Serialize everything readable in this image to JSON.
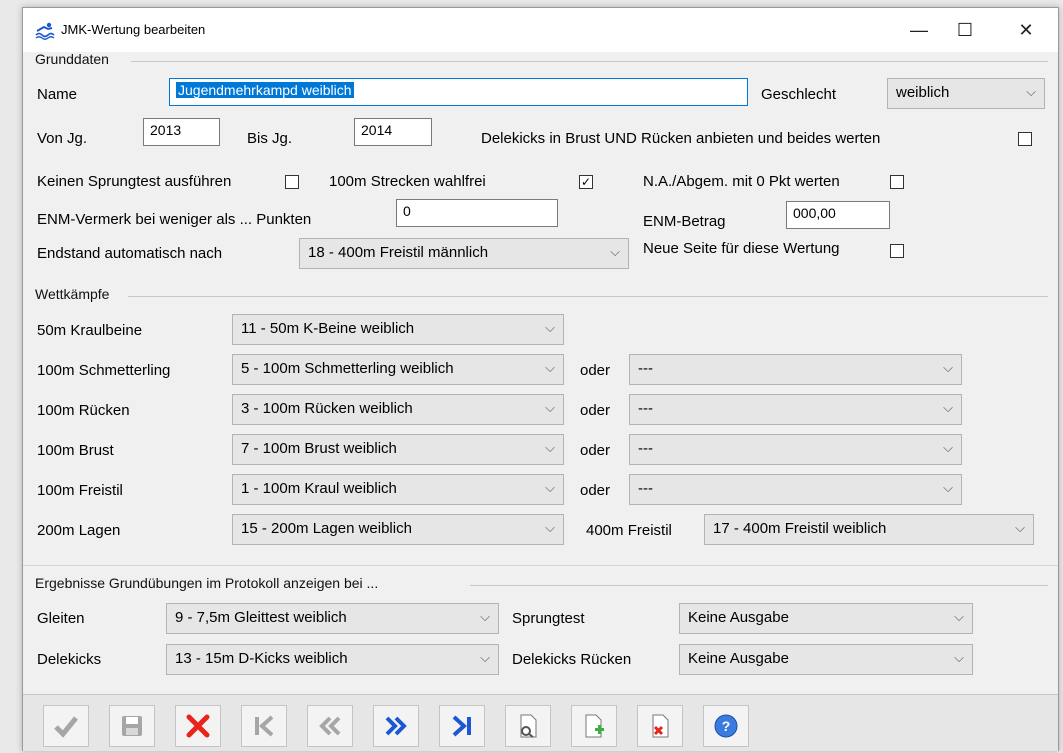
{
  "window": {
    "title": "JMK-Wertung bearbeiten"
  },
  "grunddaten": {
    "group_label": "Grunddaten",
    "name_label": "Name",
    "name_value": "Jugendmehrkampd weiblich",
    "geschlecht_label": "Geschlecht",
    "geschlecht_value": "weiblich",
    "von_label": "Von Jg.",
    "von_value": "2013",
    "bis_label": "Bis Jg.",
    "bis_value": "2014",
    "delekicks_label": "Delekicks in Brust UND Rücken anbieten und beides werten",
    "delekicks_checked": false,
    "sprungtest_label": "Keinen Sprungtest ausführen",
    "sprungtest_checked": false,
    "strecken_label": "100m Strecken wahlfrei",
    "strecken_checked": true,
    "na_label": "N.A./Abgem. mit 0 Pkt werten",
    "na_checked": false,
    "enm_vermerk_label": "ENM-Vermerk bei weniger als ... Punkten",
    "enm_vermerk_value": "0",
    "enm_betrag_label": "ENM-Betrag",
    "enm_betrag_value": "000,00",
    "endstand_label": "Endstand automatisch nach",
    "endstand_value": "18 - 400m Freistil männlich",
    "neue_seite_label": "Neue Seite für diese Wertung",
    "neue_seite_checked": false
  },
  "wettkaempfe": {
    "group_label": "Wettkämpfe",
    "oder": "oder",
    "rows": [
      {
        "label": "50m Kraulbeine",
        "value": "11 - 50m K-Beine weiblich"
      },
      {
        "label": "100m Schmetterling",
        "value": "5 - 100m Schmetterling weiblich",
        "alt": "---"
      },
      {
        "label": "100m Rücken",
        "value": "3 - 100m Rücken weiblich",
        "alt": "---"
      },
      {
        "label": "100m Brust",
        "value": "7 - 100m Brust weiblich",
        "alt": "---"
      },
      {
        "label": "100m Freistil",
        "value": "1 - 100m Kraul weiblich",
        "alt": "---"
      },
      {
        "label": "200m Lagen",
        "value": "15 - 200m Lagen weiblich"
      }
    ],
    "freistil400_label": "400m Freistil",
    "freistil400_value": "17 - 400m Freistil weiblich"
  },
  "ergebnisse": {
    "group_label": "Ergebnisse Grundübungen im Protokoll anzeigen bei ...",
    "gleiten_label": "Gleiten",
    "gleiten_value": "9 - 7,5m Gleittest weiblich",
    "delekicks_label": "Delekicks",
    "delekicks_value": "13 - 15m D-Kicks weiblich",
    "sprungtest_label": "Sprungtest",
    "sprungtest_value": "Keine Ausgabe",
    "delekicks_ruecken_label": "Delekicks Rücken",
    "delekicks_ruecken_value": "Keine Ausgabe"
  },
  "icons": {
    "arrow": "⌵",
    "minimize": "—",
    "maximize": "☐",
    "close": "✕",
    "check": "✓"
  },
  "colors": {
    "selection": "#0078d7",
    "red_icon": "#e8251d",
    "blue_icon": "#1c58d4",
    "disabled_icon": "#a6a6a6"
  }
}
